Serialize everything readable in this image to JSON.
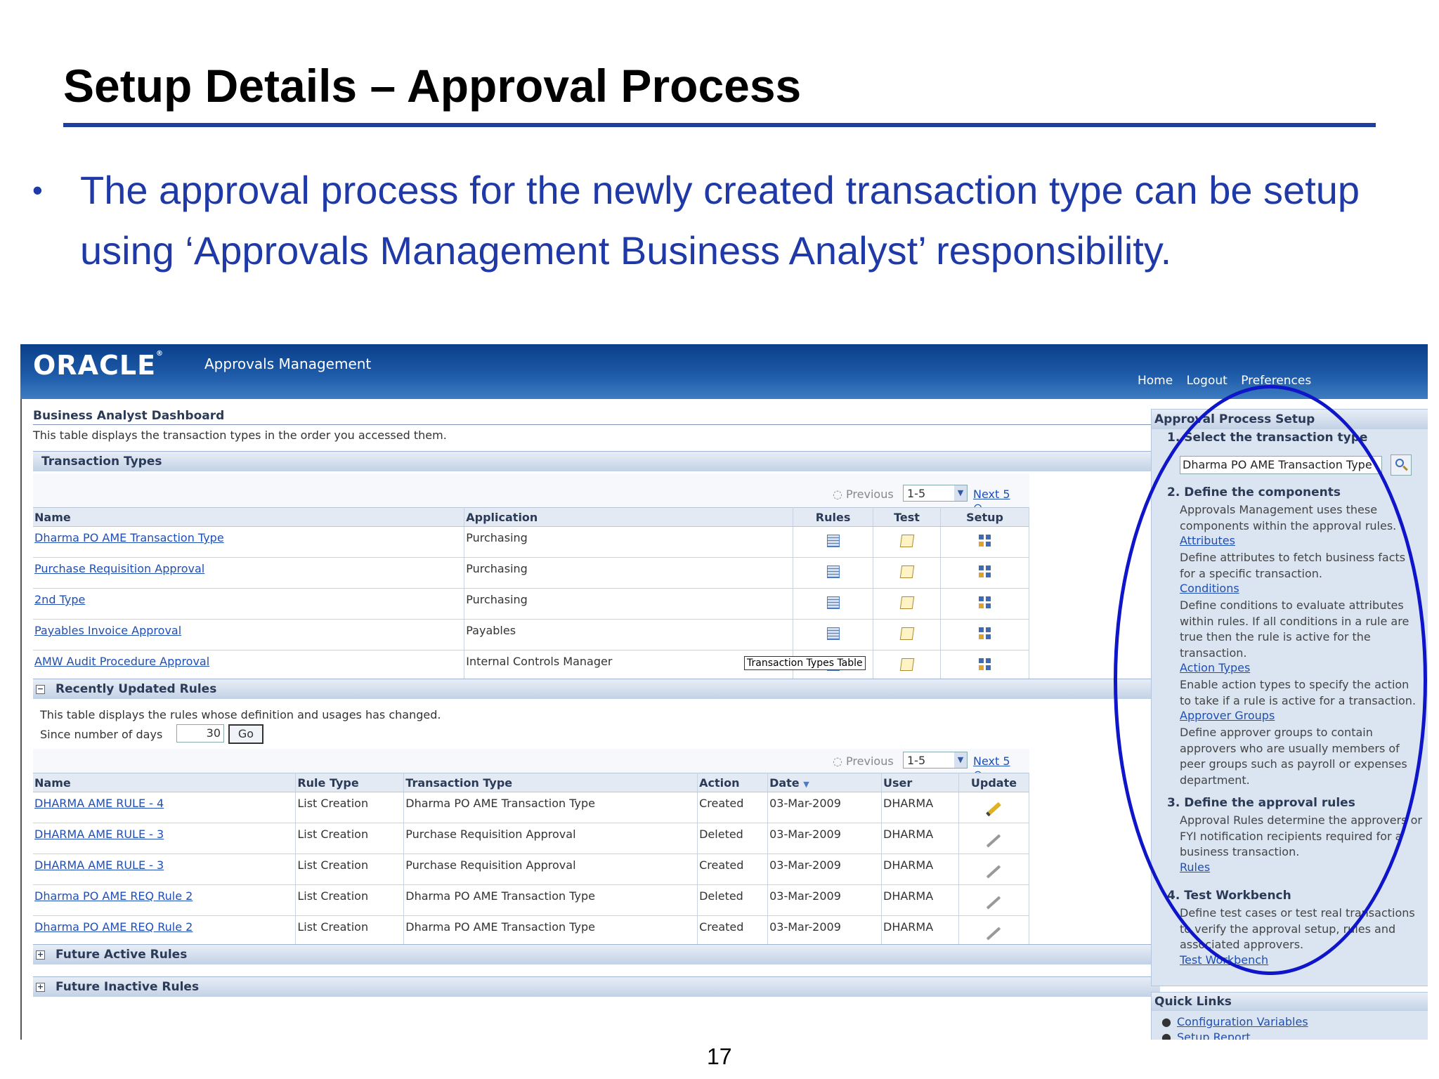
{
  "slide": {
    "title": "Setup Details – Approval Process",
    "bullet": "The approval process for the newly created transaction type can be setup using ‘Approvals Management Business Analyst’ responsibility.",
    "page_number": "17"
  },
  "app": {
    "logo": "ORACLE",
    "name": "Approvals Management",
    "links": [
      "Home",
      "Logout",
      "Preferences"
    ]
  },
  "dashboard": {
    "heading": "Business Analyst Dashboard",
    "description": "This table displays the transaction types in the order you accessed them."
  },
  "transaction_types": {
    "section_label": "Transaction Types",
    "pager": {
      "previous": "Previous",
      "range": "1-5",
      "next": "Next 5"
    },
    "columns": [
      "Name",
      "Application",
      "Rules",
      "Test",
      "Setup"
    ],
    "rows": [
      {
        "name": "Dharma PO AME Transaction Type",
        "application": "Purchasing"
      },
      {
        "name": "Purchase Requisition Approval",
        "application": "Purchasing"
      },
      {
        "name": "2nd Type",
        "application": "Purchasing"
      },
      {
        "name": "Payables Invoice Approval",
        "application": "Payables"
      },
      {
        "name": "AMW Audit Procedure Approval",
        "application": "Internal Controls Manager"
      }
    ],
    "tooltip": "Transaction Types Table"
  },
  "recent_rules": {
    "section_label": "Recently Updated Rules",
    "description": "This table displays the rules whose definition and usages has changed.",
    "days_label": "Since number of days",
    "days_value": "30",
    "go_label": "Go",
    "pager": {
      "previous": "Previous",
      "range": "1-5",
      "next": "Next 5"
    },
    "columns": [
      "Name",
      "Rule Type",
      "Transaction Type",
      "Action",
      "Date",
      "User",
      "Update"
    ],
    "rows": [
      {
        "name": "DHARMA AME RULE - 4",
        "rule_type": "List Creation",
        "transaction_type": "Dharma PO AME Transaction Type",
        "action": "Created",
        "date": "03-Mar-2009",
        "user": "DHARMA",
        "update_enabled": true
      },
      {
        "name": "DHARMA AME RULE - 3",
        "rule_type": "List Creation",
        "transaction_type": "Purchase Requisition Approval",
        "action": "Deleted",
        "date": "03-Mar-2009",
        "user": "DHARMA",
        "update_enabled": false
      },
      {
        "name": "DHARMA AME RULE - 3",
        "rule_type": "List Creation",
        "transaction_type": "Purchase Requisition Approval",
        "action": "Created",
        "date": "03-Mar-2009",
        "user": "DHARMA",
        "update_enabled": false
      },
      {
        "name": "Dharma PO AME REQ Rule 2",
        "rule_type": "List Creation",
        "transaction_type": "Dharma PO AME Transaction Type",
        "action": "Deleted",
        "date": "03-Mar-2009",
        "user": "DHARMA",
        "update_enabled": false
      },
      {
        "name": "Dharma PO AME REQ Rule 2",
        "rule_type": "List Creation",
        "transaction_type": "Dharma PO AME Transaction Type",
        "action": "Created",
        "date": "03-Mar-2009",
        "user": "DHARMA",
        "update_enabled": false
      }
    ]
  },
  "future_active": {
    "section_label": "Future Active Rules"
  },
  "future_inactive": {
    "section_label": "Future Inactive Rules"
  },
  "setup_panel": {
    "title": "Approval Process Setup",
    "step1": {
      "label": "1. Select the transaction type",
      "value": "Dharma PO AME Transaction Type"
    },
    "step2": {
      "label": "2. Define the components",
      "intro": "Approvals Management uses these components within the approval rules.",
      "items": [
        {
          "link": "Attributes",
          "text": "Define attributes to fetch business facts for a specific transaction."
        },
        {
          "link": "Conditions",
          "text": "Define conditions to evaluate attributes within rules. If all conditions in a rule are true then the rule is active for the transaction."
        },
        {
          "link": "Action Types",
          "text": "Enable action types to specify the action to take if a rule is active for a transaction."
        },
        {
          "link": "Approver Groups",
          "text": "Define approver groups to contain approvers who are usually members of peer groups such as payroll or expenses department."
        }
      ]
    },
    "step3": {
      "label": "3. Define the approval rules",
      "text": "Approval Rules determine the approvers or FYI notification recipients required for a business transaction.",
      "link": "Rules"
    },
    "step4": {
      "label": "4. Test Workbench",
      "text": "Define test cases or test real transactions to verify the approval setup, rules and associated approvers.",
      "link": "Test Workbench"
    }
  },
  "quick_links": {
    "title": "Quick Links",
    "items": [
      "Configuration Variables",
      "Setup Report"
    ]
  },
  "colors": {
    "title_rule": "#1f3f9e",
    "bullet_text": "#1f3aa6",
    "highlight_ellipse": "#0f15c8",
    "header_blue": "#0a3f8a",
    "link": "#1f4fb5"
  }
}
